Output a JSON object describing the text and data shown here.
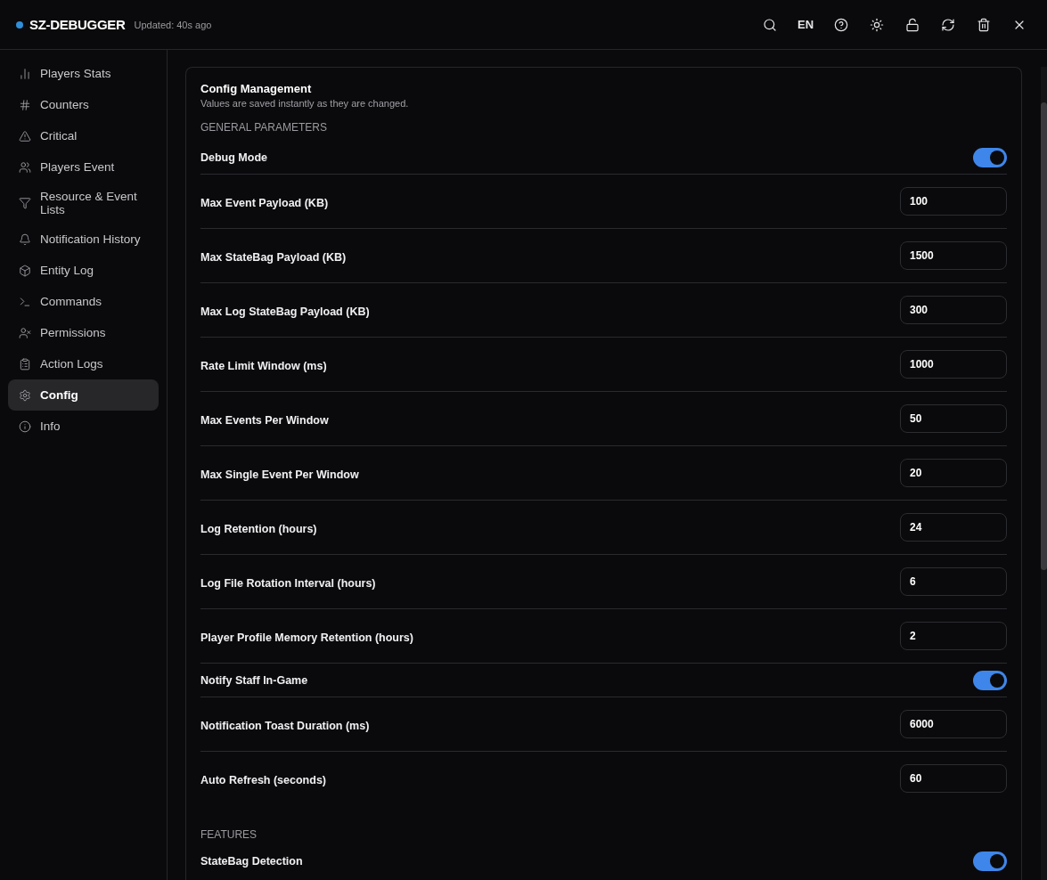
{
  "header": {
    "title": "SZ-DEBUGGER",
    "updated": "Updated: 40s ago",
    "actions": [
      {
        "kind": "search"
      },
      {
        "kind": "text",
        "label": "EN"
      },
      {
        "kind": "help"
      },
      {
        "kind": "theme"
      },
      {
        "kind": "lock"
      },
      {
        "kind": "refresh"
      },
      {
        "kind": "delete"
      },
      {
        "kind": "close"
      }
    ]
  },
  "sidebar": {
    "items": [
      {
        "label": "Players Stats",
        "selected": false
      },
      {
        "label": "Counters",
        "selected": false
      },
      {
        "label": "Critical",
        "selected": false
      },
      {
        "label": "Players Event",
        "selected": false
      },
      {
        "label": "Resource & Event Lists",
        "selected": false
      },
      {
        "label": "Notification History",
        "selected": false
      },
      {
        "label": "Entity Log",
        "selected": false
      },
      {
        "label": "Commands",
        "selected": false
      },
      {
        "label": "Permissions",
        "selected": false
      },
      {
        "label": "Action Logs",
        "selected": false
      },
      {
        "label": "Config",
        "selected": true
      },
      {
        "label": "Info",
        "selected": false
      }
    ]
  },
  "config": {
    "title": "Config Management",
    "subtitle": "Values are saved instantly as they are changed.",
    "sections": [
      {
        "title": "GENERAL PARAMETERS",
        "rows": [
          {
            "kind": "toggle",
            "label": "Debug Mode",
            "on": true
          },
          {
            "kind": "number",
            "label": "Max Event Payload (KB)",
            "value": "100"
          },
          {
            "kind": "number",
            "label": "Max StateBag Payload (KB)",
            "value": "1500"
          },
          {
            "kind": "number",
            "label": "Max Log StateBag Payload (KB)",
            "value": "300"
          },
          {
            "kind": "number",
            "label": "Rate Limit Window (ms)",
            "value": "1000"
          },
          {
            "kind": "number",
            "label": "Max Events Per Window",
            "value": "50"
          },
          {
            "kind": "number",
            "label": "Max Single Event Per Window",
            "value": "20"
          },
          {
            "kind": "number",
            "label": "Log Retention (hours)",
            "value": "24"
          },
          {
            "kind": "number",
            "label": "Log File Rotation Interval (hours)",
            "value": "6"
          },
          {
            "kind": "number",
            "label": "Player Profile Memory Retention (hours)",
            "value": "2"
          },
          {
            "kind": "toggle",
            "label": "Notify Staff In-Game",
            "on": true
          },
          {
            "kind": "number",
            "label": "Notification Toast Duration (ms)",
            "value": "6000"
          },
          {
            "kind": "number",
            "label": "Auto Refresh (seconds)",
            "value": "60"
          }
        ]
      },
      {
        "title": "FEATURES",
        "rows": [
          {
            "kind": "toggle",
            "label": "StateBag Detection",
            "on": true
          }
        ]
      }
    ]
  }
}
